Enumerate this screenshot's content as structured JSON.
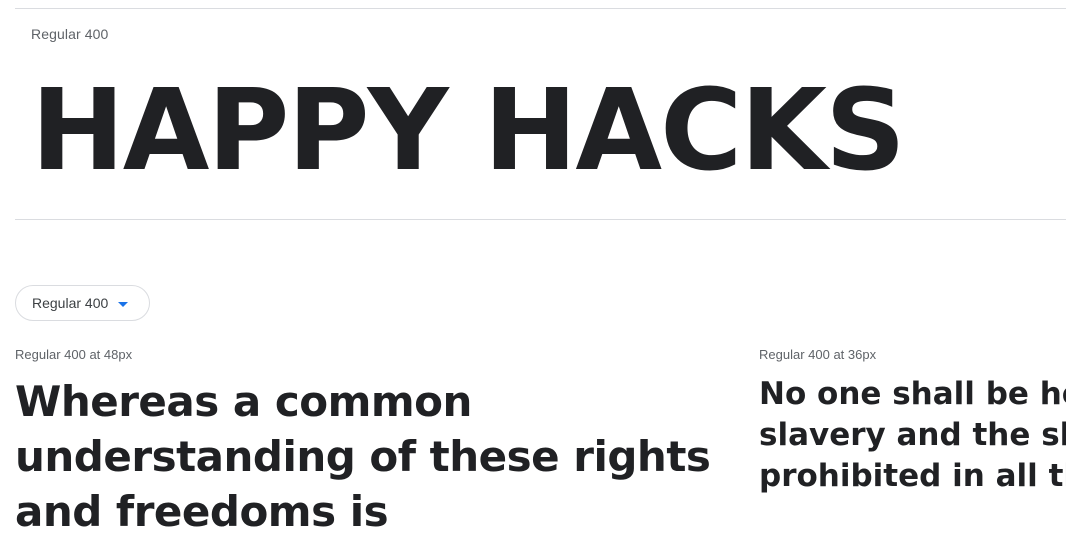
{
  "header": {
    "style_label": "Regular 400",
    "preview_text": "HAPPY HACKS"
  },
  "style_selector": {
    "label": "Regular 400",
    "accent_color": "#1a73e8",
    "icon": "caret-down-icon"
  },
  "samples": [
    {
      "meta": "Regular 400 at 48px",
      "text": "Whereas a common understanding of these rights and freedoms is"
    },
    {
      "meta": "Regular 400 at 36px",
      "lines": [
        "No one shall be held i",
        "slavery and the slave",
        "prohibited in all their"
      ]
    }
  ]
}
